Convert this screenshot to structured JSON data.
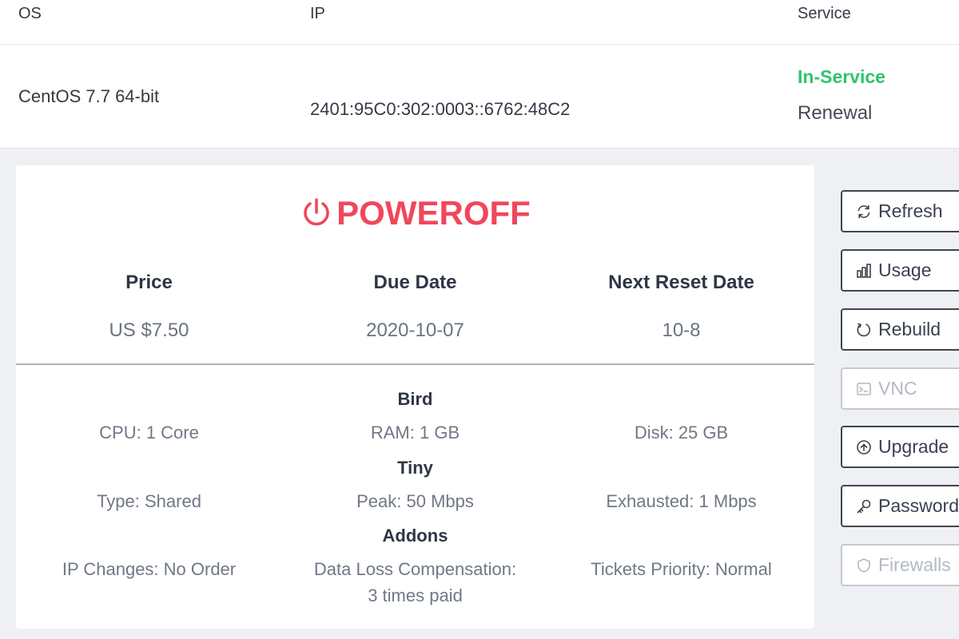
{
  "table": {
    "headers": {
      "os": "OS",
      "ip": "IP",
      "service": "Service"
    },
    "row": {
      "os": "CentOS 7.7 64-bit",
      "ip": "2401:95C0:302:0003::6762:48C2",
      "status": "In-Service",
      "renewal": "Renewal"
    }
  },
  "card": {
    "power_status": "POWEROFF",
    "price": {
      "label": "Price",
      "value": "US $7.50"
    },
    "due_date": {
      "label": "Due Date",
      "value": "2020-10-07"
    },
    "next_reset": {
      "label": "Next Reset Date",
      "value": "10-8"
    },
    "plan": {
      "name": "Bird",
      "cpu": "CPU: 1 Core",
      "ram": "RAM: 1 GB",
      "disk": "Disk: 25 GB"
    },
    "network": {
      "name": "Tiny",
      "type": "Type: Shared",
      "peak": "Peak: 50 Mbps",
      "exhausted": "Exhausted: 1 Mbps"
    },
    "addons": {
      "name": "Addons",
      "ip_changes": "IP Changes: No Order",
      "data_loss_1": "Data Loss Compensation:",
      "data_loss_2": "3 times paid",
      "tickets": "Tickets Priority: Normal"
    }
  },
  "actions": {
    "refresh": "Refresh",
    "usage": "Usage",
    "rebuild": "Rebuild",
    "vnc": "VNC",
    "upgrade": "Upgrade",
    "password": "Password",
    "firewalls": "Firewalls"
  },
  "colors": {
    "in_service": "#2ec36b",
    "poweroff": "#f0475b",
    "disabled": "#b3bac4"
  },
  "icons": {
    "power": "power-icon",
    "refresh": "refresh-icon",
    "usage": "bar-chart-icon",
    "rebuild": "rebuild-icon",
    "vnc": "terminal-icon",
    "upgrade": "arrow-up-circle-icon",
    "password": "key-icon",
    "firewalls": "shield-icon"
  }
}
